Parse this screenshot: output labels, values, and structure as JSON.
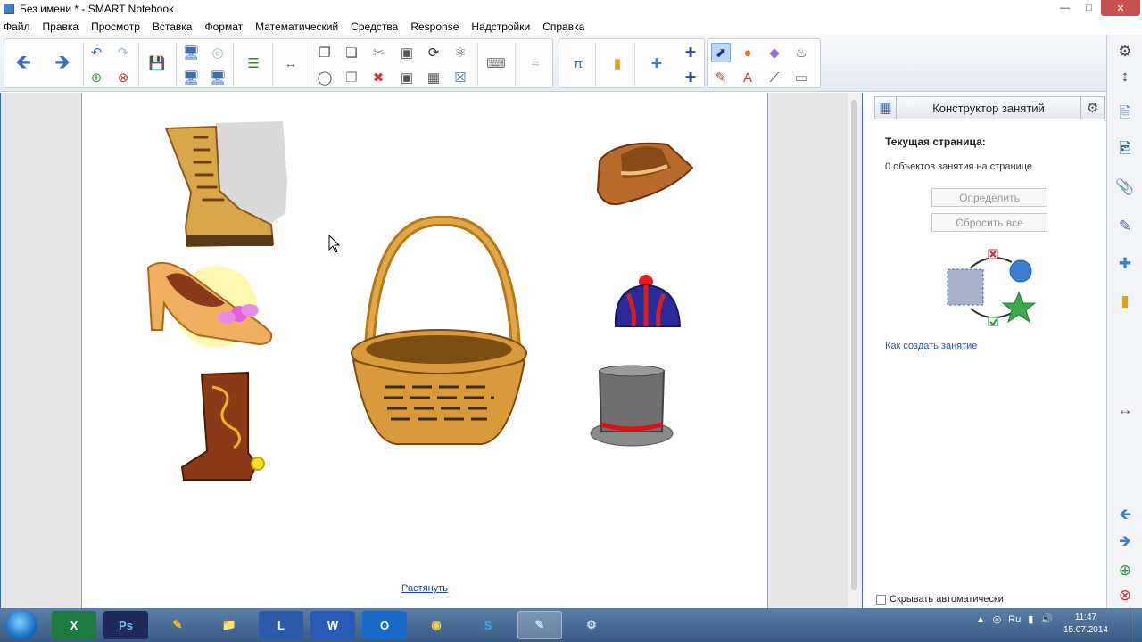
{
  "window": {
    "title": "Без имени * - SMART Notebook"
  },
  "menu": [
    "Файл",
    "Правка",
    "Просмотр",
    "Вставка",
    "Формат",
    "Математический",
    "Средства",
    "Response",
    "Надстройки",
    "Справка"
  ],
  "page": {
    "stretch_link": "Растянуть"
  },
  "panel": {
    "title": "Конструктор занятий",
    "current_page": "Текущая страница:",
    "objects_count": "0 объектов занятия на странице",
    "define_button": "Определить",
    "reset_button": "Сбросить все",
    "howto_link": "Как создать занятие",
    "auto_hide": "Скрывать автоматически"
  },
  "taskbar": {
    "language": "Ru",
    "time": "11:47",
    "date": "15.07.2014"
  },
  "colors": {
    "accent": "#3a6fb5",
    "selection": "#bcd8f6"
  }
}
